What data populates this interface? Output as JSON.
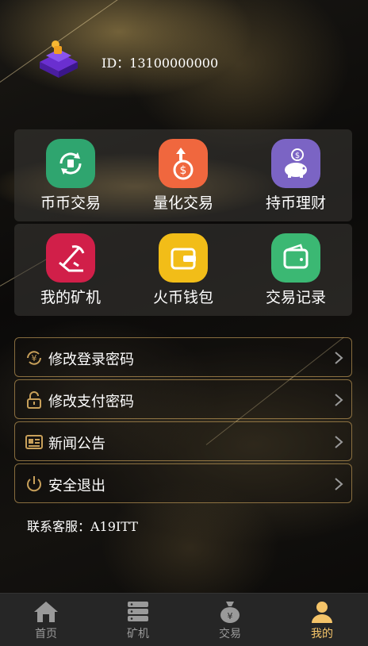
{
  "header": {
    "user_id": "ID：13100000000"
  },
  "grid": [
    {
      "label": "币币交易",
      "icon": "swap-circle-icon",
      "color": "#2fa56f"
    },
    {
      "label": "量化交易",
      "icon": "coin-up-arrow-icon",
      "color": "#f0673e"
    },
    {
      "label": "持币理财",
      "icon": "piggy-bank-icon",
      "color": "#7b64c4"
    },
    {
      "label": "我的矿机",
      "icon": "pickaxe-icon",
      "color": "#d11f49"
    },
    {
      "label": "火币钱包",
      "icon": "wallet-icon",
      "color": "#f2bd18"
    },
    {
      "label": "交易记录",
      "icon": "wallet-record-icon",
      "color": "#3bb873"
    }
  ],
  "menu": [
    {
      "label": "修改登录密码",
      "icon": "yuan-cycle-icon"
    },
    {
      "label": "修改支付密码",
      "icon": "unlock-icon"
    },
    {
      "label": "新闻公告",
      "icon": "newspaper-icon"
    },
    {
      "label": "安全退出",
      "icon": "power-icon"
    }
  ],
  "contact": "联系客服：A19ITT",
  "tabs": [
    {
      "label": "首页",
      "icon": "home-icon",
      "active": false
    },
    {
      "label": "矿机",
      "icon": "server-icon",
      "active": false
    },
    {
      "label": "交易",
      "icon": "money-bag-icon",
      "active": false
    },
    {
      "label": "我的",
      "icon": "user-icon",
      "active": true
    }
  ],
  "colors": {
    "accent": "#f5c469",
    "menu_border": "#c8a05a",
    "tab_inactive": "#9a9a9a"
  }
}
